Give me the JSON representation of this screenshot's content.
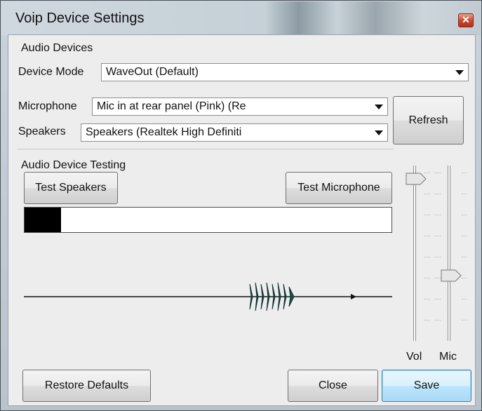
{
  "window": {
    "title": "Voip Device Settings",
    "close_glyph": "✕"
  },
  "audio_devices": {
    "group_title": "Audio Devices",
    "device_mode_label": "Device Mode",
    "device_mode_value": "WaveOut (Default)",
    "microphone_label": "Microphone",
    "microphone_value": "Mic in at rear panel (Pink) (Re",
    "speakers_label": "Speakers",
    "speakers_value": "Speakers (Realtek High Definiti",
    "refresh_label": "Refresh"
  },
  "audio_testing": {
    "group_title": "Audio Device Testing",
    "test_speakers_label": "Test Speakers",
    "test_microphone_label": "Test Microphone",
    "meter_level": 0.1
  },
  "sliders": {
    "vol_label": "Vol",
    "mic_label": "Mic",
    "vol_level": 1.0,
    "mic_level": 0.35
  },
  "footer": {
    "restore_label": "Restore Defaults",
    "close_label": "Close",
    "save_label": "Save"
  },
  "icons": {
    "close": "close-icon",
    "dropdown": "chevron-down-icon",
    "slider_thumb": "slider-thumb-icon"
  }
}
